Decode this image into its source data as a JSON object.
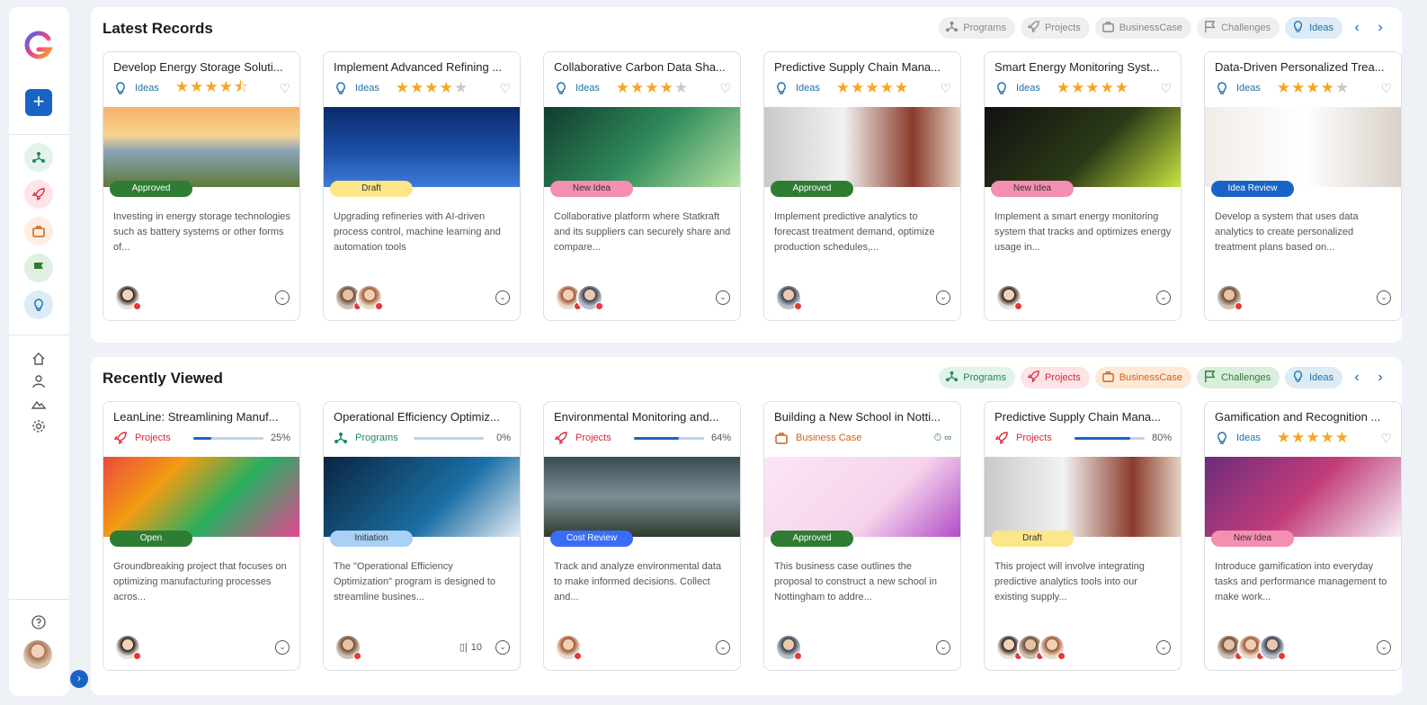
{
  "sidebar": {
    "add_label": "+",
    "collapse_label": "›"
  },
  "latest": {
    "title": "Latest Records",
    "filters": [
      {
        "label": "Programs",
        "icon": "programs-icon",
        "active": false
      },
      {
        "label": "Projects",
        "icon": "projects-icon",
        "active": false
      },
      {
        "label": "BusinessCase",
        "icon": "businesscase-icon",
        "active": false
      },
      {
        "label": "Challenges",
        "icon": "challenges-icon",
        "active": false
      },
      {
        "label": "Ideas",
        "icon": "ideas-icon",
        "active": true
      }
    ],
    "prev": "‹",
    "next": "›",
    "cards": [
      {
        "title": "Develop Energy Storage Soluti...",
        "type": "Ideas",
        "rating": 4.5,
        "badge": "Approved",
        "desc": "Investing in energy storage technologies such as battery systems or other forms of...",
        "avatars": 1
      },
      {
        "title": "Implement Advanced Refining ...",
        "type": "Ideas",
        "rating": 4,
        "badge": "Draft",
        "desc": "Upgrading refineries with AI-driven process control, machine learning and automation tools",
        "avatars": 2
      },
      {
        "title": "Collaborative Carbon Data Sha...",
        "type": "Ideas",
        "rating": 4,
        "badge": "New Idea",
        "desc": "Collaborative platform where Statkraft and its suppliers can securely share and compare...",
        "avatars": 2
      },
      {
        "title": "Predictive Supply Chain Mana...",
        "type": "Ideas",
        "rating": 5,
        "badge": "Approved",
        "desc": "Implement predictive analytics to forecast treatment demand, optimize production schedules,...",
        "avatars": 1
      },
      {
        "title": "Smart Energy Monitoring Syst...",
        "type": "Ideas",
        "rating": 5,
        "badge": "New Idea",
        "desc": "Implement a smart energy monitoring system that tracks and optimizes energy usage in...",
        "avatars": 1
      },
      {
        "title": "Data-Driven Personalized Trea...",
        "type": "Ideas",
        "rating": 4,
        "badge": "Idea Review",
        "desc": "Develop a system that uses data analytics to create personalized treatment plans based on...",
        "avatars": 1
      }
    ]
  },
  "recent": {
    "title": "Recently Viewed",
    "filters": [
      {
        "label": "Programs",
        "icon": "programs-icon",
        "active": true
      },
      {
        "label": "Projects",
        "icon": "projects-icon",
        "active": true
      },
      {
        "label": "BusinessCase",
        "icon": "businesscase-icon",
        "active": true
      },
      {
        "label": "Challenges",
        "icon": "challenges-icon",
        "active": true
      },
      {
        "label": "Ideas",
        "icon": "ideas-icon",
        "active": true
      }
    ],
    "prev": "‹",
    "next": "›",
    "cards": [
      {
        "title": "LeanLine: Streamlining Manuf...",
        "type": "Projects",
        "progress": 25,
        "pct": "25%",
        "badge": "Open",
        "desc": "Groundbreaking project that focuses on optimizing manufacturing processes acros...",
        "avatars": 1
      },
      {
        "title": "Operational Efficiency Optimiz...",
        "type": "Programs",
        "progress": 0,
        "pct": "0%",
        "badge": "Initiation",
        "desc": "The \"Operational Efficiency Optimization\" program is designed to streamline busines...",
        "avatars": 1,
        "count": "10"
      },
      {
        "title": "Environmental Monitoring and...",
        "type": "Projects",
        "progress": 64,
        "pct": "64%",
        "badge": "Cost Review",
        "desc": "Track and analyze environmental data to make informed decisions. Collect and...",
        "avatars": 1
      },
      {
        "title": "Building a New School in Notti...",
        "type": "Business Case",
        "infinity": "⏱ ∞",
        "badge": "Approved",
        "desc": "This business case outlines the proposal to construct a new school in Nottingham to addre...",
        "avatars": 1
      },
      {
        "title": "Predictive Supply Chain Mana...",
        "type": "Projects",
        "progress": 80,
        "pct": "80%",
        "badge": "Draft",
        "desc": "This project will involve integrating predictive analytics tools into our existing supply...",
        "avatars": 3
      },
      {
        "title": "Gamification and Recognition ...",
        "type": "Ideas",
        "rating": 5,
        "badge": "New Idea",
        "desc": "Introduce gamification into everyday tasks and performance management to make work...",
        "avatars": 3
      }
    ]
  },
  "colors": {
    "accent": "#1a63c6",
    "programs": "#1e8a5a",
    "projects": "#d62839",
    "businesscase": "#c9631a",
    "challenges": "#2e7d32",
    "ideas": "#1a73a8",
    "star": "#f5a623"
  }
}
